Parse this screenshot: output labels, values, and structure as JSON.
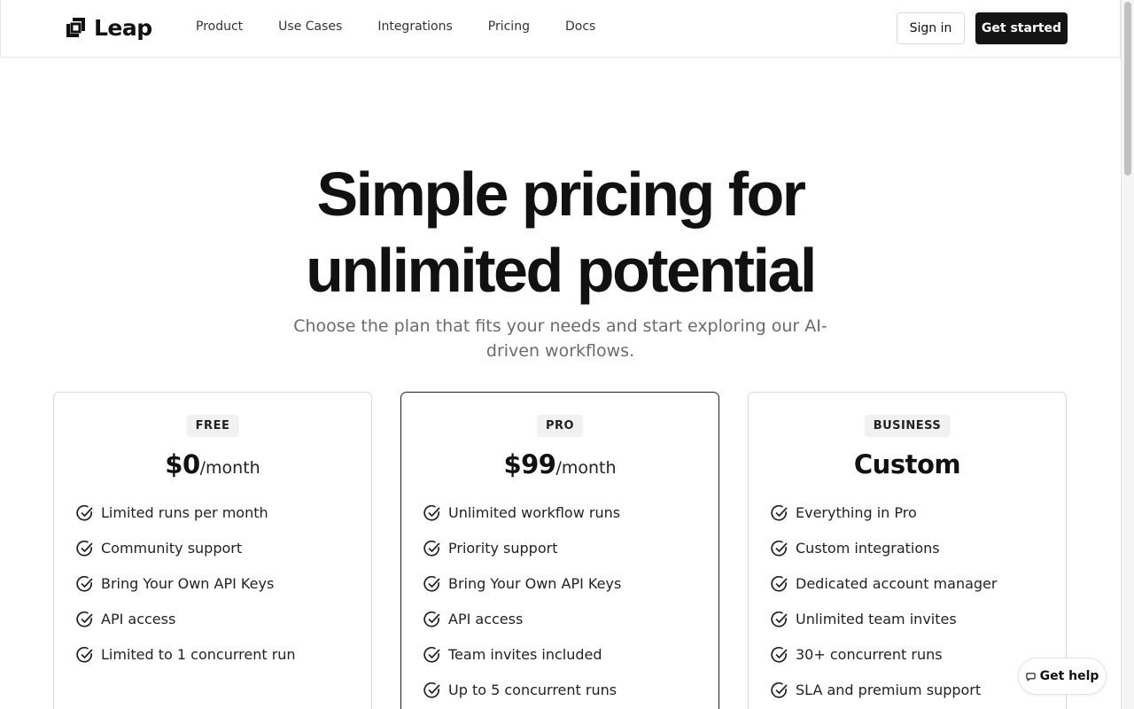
{
  "brand": {
    "name": "Leap"
  },
  "nav": {
    "items": [
      "Product",
      "Use Cases",
      "Integrations",
      "Pricing",
      "Docs"
    ],
    "sign_in": "Sign in",
    "get_started": "Get started"
  },
  "hero": {
    "title_line1": "Simple pricing for",
    "title_line2": "unlimited potential",
    "subtitle": "Choose the plan that fits your needs and start exploring our AI-driven workflows."
  },
  "plans": [
    {
      "badge": "FREE",
      "amount": "$0",
      "unit": "/month",
      "features": [
        "Limited runs per month",
        "Community support",
        "Bring Your Own API Keys",
        "API access",
        "Limited to 1 concurrent run"
      ]
    },
    {
      "badge": "PRO",
      "amount": "$99",
      "unit": "/month",
      "features": [
        "Unlimited workflow runs",
        "Priority support",
        "Bring Your Own API Keys",
        "API access",
        "Team invites included",
        "Up to 5 concurrent runs"
      ]
    },
    {
      "badge": "BUSINESS",
      "amount": "Custom",
      "unit": "",
      "features": [
        "Everything in Pro",
        "Custom integrations",
        "Dedicated account manager",
        "Unlimited team invites",
        "30+ concurrent runs",
        "SLA and premium support"
      ]
    }
  ],
  "help": {
    "label": "Get help"
  },
  "icons": {
    "feature": "check-circle-icon",
    "help": "chat-bubble-icon",
    "logo": "leap-logo-icon"
  },
  "colors": {
    "primary_button": "#141414",
    "muted_text": "#6b6b6b",
    "border": "#d9d9d9"
  }
}
